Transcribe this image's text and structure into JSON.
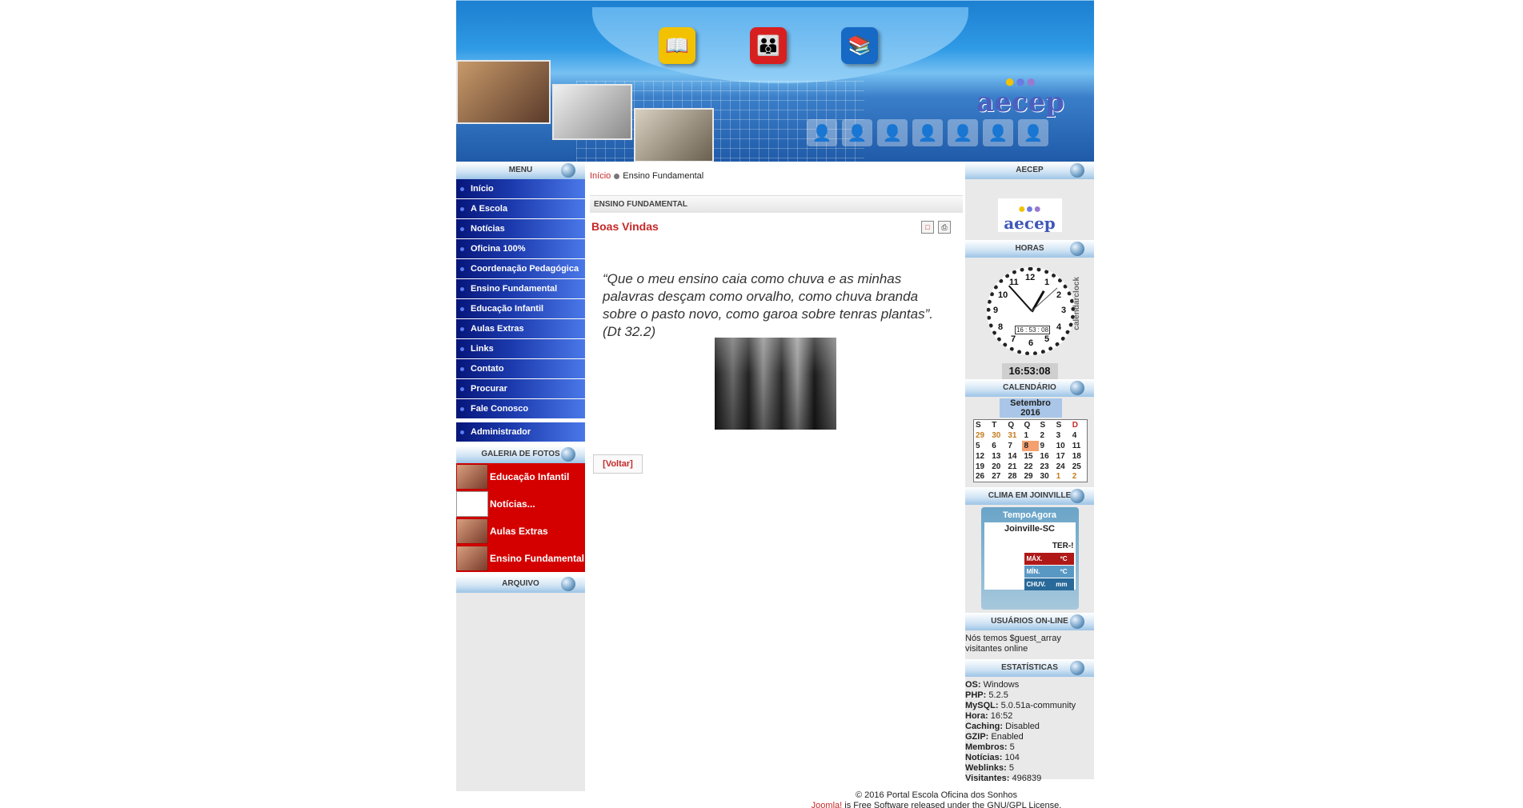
{
  "header": {
    "logo_text": "aecep"
  },
  "left_menu": {
    "heading": "MENU",
    "items": [
      {
        "label": "Início"
      },
      {
        "label": "A Escola"
      },
      {
        "label": "Notícias"
      },
      {
        "label": "Oficina 100%"
      },
      {
        "label": "Coordenação Pedagógica"
      },
      {
        "label": "Ensino Fundamental"
      },
      {
        "label": "Educação Infantil"
      },
      {
        "label": "Aulas Extras"
      },
      {
        "label": "Links"
      },
      {
        "label": "Contato"
      },
      {
        "label": "Procurar"
      },
      {
        "label": "Fale Conosco"
      }
    ],
    "admin_label": "Administrador"
  },
  "gallery": {
    "heading": "GALERIA DE FOTOS",
    "items": [
      {
        "label": "Educação Infantil"
      },
      {
        "label": "Notícias..."
      },
      {
        "label": "Aulas Extras"
      },
      {
        "label": "Ensino Fundamental"
      }
    ]
  },
  "archive": {
    "heading": "ARQUIVO"
  },
  "content": {
    "breadcrumb_home": "Início",
    "breadcrumb_current": "Ensino Fundamental",
    "section_title": "ENSINO FUNDAMENTAL",
    "article_title": "Boas Vindas",
    "quote": "“Que o meu ensino caia como chuva e as minhas palavras desçam como orvalho, como chuva branda sobre o pasto novo, como garoa sobre tenras plantas”.    (Dt 32.2)",
    "back_label": "[Voltar]"
  },
  "right": {
    "aecep_heading": "AECEP",
    "aecep_logo_text": "aecep",
    "hours_heading": "HORAS",
    "clock_digital": "16 : 53 : 08",
    "clock_brand": "calendarclock",
    "time": "16:53:08",
    "calendar_heading": "CALENDÁRIO",
    "calendar": {
      "month": "Setembro 2016",
      "weekdays": [
        "S",
        "T",
        "Q",
        "Q",
        "S",
        "S",
        "D"
      ],
      "weeks": [
        [
          "29",
          "30",
          "31",
          "1",
          "2",
          "3",
          "4"
        ],
        [
          "5",
          "6",
          "7",
          "8",
          "9",
          "10",
          "11"
        ],
        [
          "12",
          "13",
          "14",
          "15",
          "16",
          "17",
          "18"
        ],
        [
          "19",
          "20",
          "21",
          "22",
          "23",
          "24",
          "25"
        ],
        [
          "26",
          "27",
          "28",
          "29",
          "30",
          "1",
          "2"
        ]
      ],
      "today": "8"
    },
    "weather_heading": "CLIMA EM JOINVILLE",
    "weather": {
      "brand": "TempoAgora",
      "city": "Joinville-SC",
      "day": "TER-!",
      "rows": [
        {
          "label": "MÁX.",
          "value": "ºC"
        },
        {
          "label": "MÍN.",
          "value": "ºC"
        },
        {
          "label": "CHUV.",
          "value": "mm"
        }
      ]
    },
    "online_heading": "USUÁRIOS ON-LINE",
    "online_text": "Nós temos $guest_array visitantes online",
    "stats_heading": "ESTATÍSTICAS",
    "stats": [
      {
        "label": "OS:",
        "value": "Windows"
      },
      {
        "label": "PHP:",
        "value": "5.2.5"
      },
      {
        "label": "MySQL:",
        "value": "5.0.51a-community"
      },
      {
        "label": "Hora:",
        "value": "16:52"
      },
      {
        "label": "Caching:",
        "value": "Disabled"
      },
      {
        "label": "GZIP:",
        "value": "Enabled"
      },
      {
        "label": "Membros:",
        "value": "5"
      },
      {
        "label": "Notícias:",
        "value": "104"
      },
      {
        "label": "Weblinks:",
        "value": "5"
      },
      {
        "label": "Visitantes:",
        "value": "496839"
      }
    ]
  },
  "footer": {
    "copyright": "© 2016 Portal Escola Oficina dos Sonhos",
    "joomla_link": "Joomla!",
    "license": " is Free Software released under the GNU/GPL License."
  }
}
